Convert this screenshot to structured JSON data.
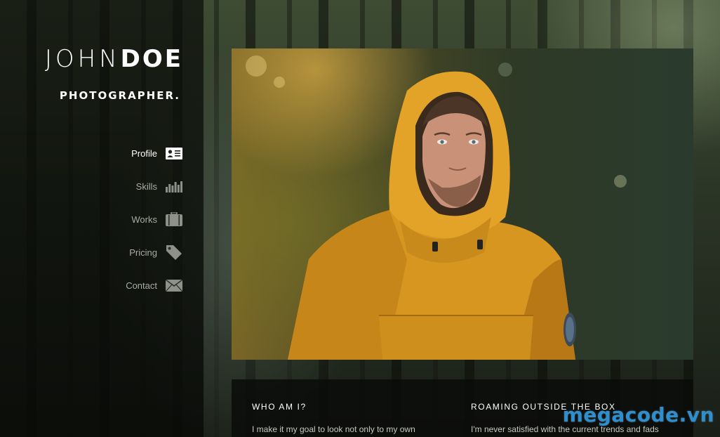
{
  "brand": {
    "first": "JOHN",
    "last": "DOE",
    "tagline": "PHOTOGRAPHER."
  },
  "nav": [
    {
      "label": "Profile",
      "icon": "profile-card-icon",
      "active": true
    },
    {
      "label": "Skills",
      "icon": "bar-chart-icon",
      "active": false
    },
    {
      "label": "Works",
      "icon": "briefcase-icon",
      "active": false
    },
    {
      "label": "Pricing",
      "icon": "price-tag-icon",
      "active": false
    },
    {
      "label": "Contact",
      "icon": "envelope-icon",
      "active": false
    }
  ],
  "sections": [
    {
      "heading": "WHO AM I?",
      "text": "I make it my goal to look not only to my own"
    },
    {
      "heading": "ROAMING OUTSIDE THE BOX",
      "text": "I'm never satisfied with the current trends and fads"
    }
  ],
  "watermark": "megacode.vn",
  "colors": {
    "accent_watermark": "#2d8fd0",
    "jacket": "#e0a02a"
  }
}
